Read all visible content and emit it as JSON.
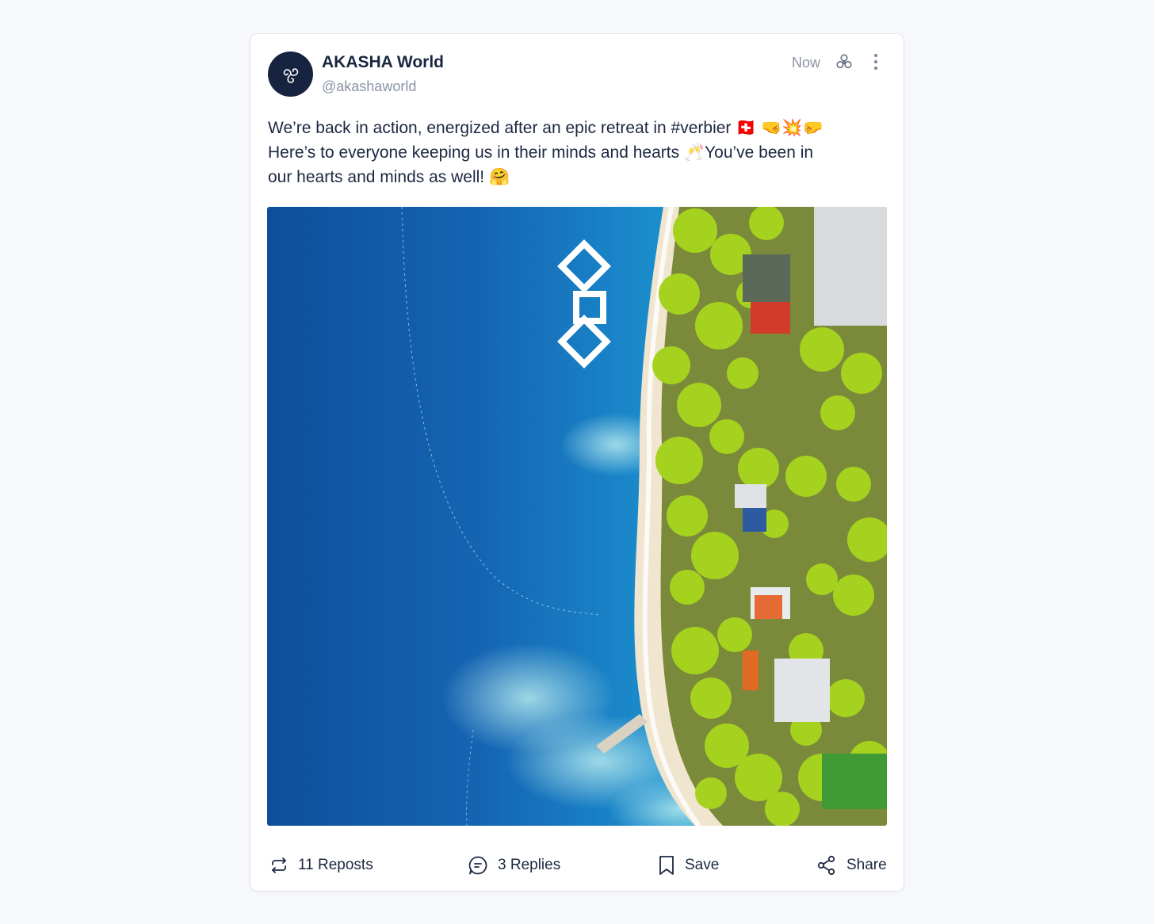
{
  "post": {
    "author_name": "AKASHA World",
    "author_handle": "@akashaworld",
    "timestamp": "Now",
    "text_lines": [
      "We’re back in action, energized after an epic retreat in #verbier 🇨🇭 🤜💥🤛",
      "Here’s to everyone keeping us in their minds and hearts 🥂You’ve been in",
      "our hearts and minds as well! 🤗"
    ],
    "image_icon": "aerial-beach-photo"
  },
  "actions": {
    "reposts_label": "11 Reposts",
    "replies_label": "3 Replies",
    "save_label": "Save",
    "share_label": "Share"
  },
  "icons": {
    "avatar": "triskelion-logo-icon",
    "network": "triskelion-network-icon",
    "more": "more-vertical-icon",
    "repost": "repost-icon",
    "reply": "reply-bubble-icon",
    "save": "bookmark-icon",
    "share": "share-icon"
  },
  "colors": {
    "avatar_bg": "#172440",
    "text": "#1c2742",
    "muted": "#8a93a6",
    "sea_deep": "#1560a8",
    "sea_shallow": "#2bb8c9",
    "trees": "#9ccc1e"
  }
}
